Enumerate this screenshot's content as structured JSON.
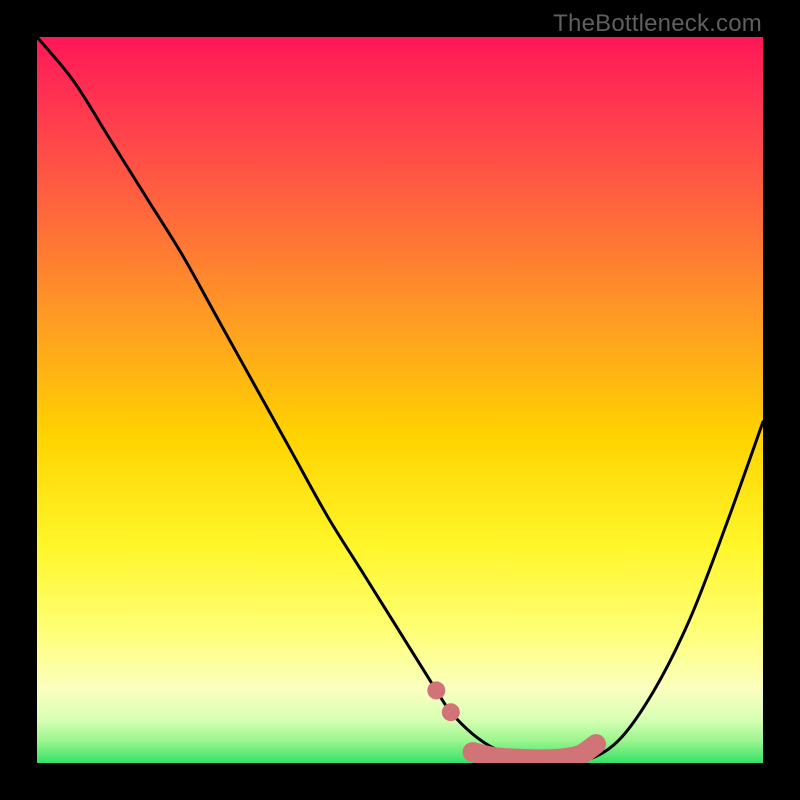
{
  "attribution": "TheBottleneck.com",
  "colors": {
    "background_black": "#000000",
    "gradient_top": "#ff1757",
    "gradient_mid_orange": "#ffa400",
    "gradient_yellow": "#ffff4a",
    "gradient_pale": "#f8ffc8",
    "gradient_green": "#3be66a",
    "curve_stroke": "#000000",
    "marker_fill": "#d17377"
  },
  "chart_data": {
    "type": "line",
    "title": "",
    "xlabel": "",
    "ylabel": "",
    "xlim": [
      0,
      100
    ],
    "ylim": [
      0,
      100
    ],
    "x": [
      0,
      5,
      10,
      15,
      20,
      25,
      30,
      35,
      40,
      45,
      50,
      55,
      57,
      60,
      63,
      66,
      70,
      75,
      80,
      85,
      90,
      95,
      100
    ],
    "y": [
      100,
      94,
      86,
      78,
      70,
      61,
      52,
      43,
      34,
      26,
      18,
      10,
      7,
      4,
      2,
      1,
      0.2,
      0.2,
      3,
      10,
      20,
      33,
      47
    ],
    "markers": {
      "x": [
        55,
        57,
        60,
        63,
        66,
        70,
        73,
        75,
        77
      ],
      "y": [
        10,
        7,
        1.5,
        0.8,
        0.6,
        0.5,
        0.7,
        1.2,
        2.6
      ]
    }
  }
}
